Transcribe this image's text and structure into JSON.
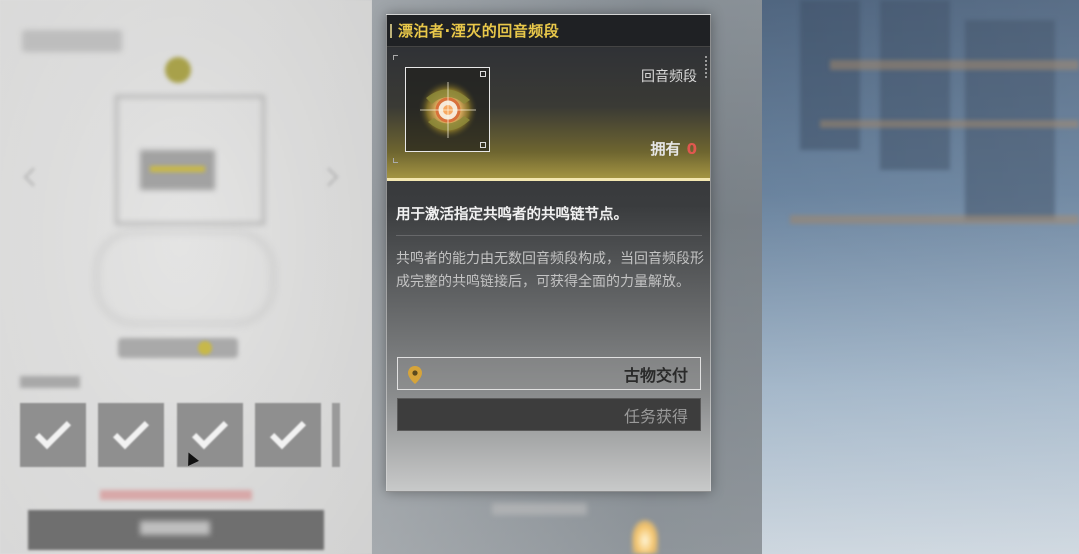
{
  "card": {
    "title": "漂泊者·湮灭的回音频段",
    "item_type": "回音频段",
    "owned_label": "拥有",
    "owned_count": "0",
    "description_main": "用于激活指定共鸣者的共鸣链节点。",
    "description_body": "共鸣者的能力由无数回音频段构成，当回音频段形成完整的共鸣链接后，可获得全面的力量解放。",
    "sources": [
      {
        "label": "古物交付",
        "icon": "location-pin-icon"
      },
      {
        "label": "任务获得"
      }
    ]
  },
  "background": {
    "checked_tiles": 4
  },
  "colors": {
    "title_gold": "#e9c84a",
    "owned_count_red": "#e0584f",
    "hero_gold": "#a39442"
  }
}
